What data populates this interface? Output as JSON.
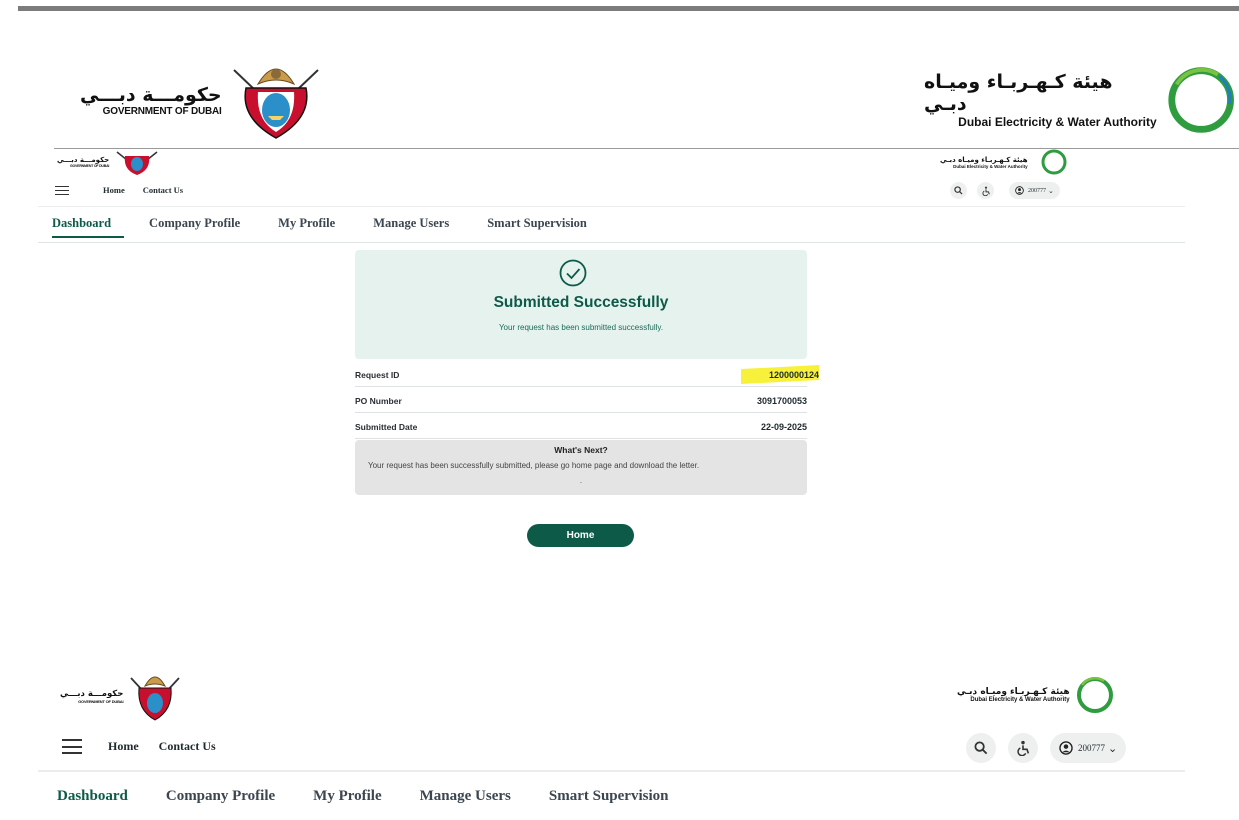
{
  "brand": {
    "gov_arabic": "حكومـــة دبـــي",
    "gov_english": "GOVERNMENT OF DUBAI",
    "dewa_arabic": "هيئة كـهـربـاء وميـاه دبـي",
    "dewa_english": "Dubai Electricity & Water Authority"
  },
  "nav": {
    "home": "Home",
    "contact": "Contact Us",
    "user_id": "200777"
  },
  "tabs": [
    "Dashboard",
    "Company Profile",
    "My Profile",
    "Manage Users",
    "Smart Supervision"
  ],
  "success": {
    "title": "Submitted Successfully",
    "message": "Your request has been submitted successfully."
  },
  "details": [
    {
      "label": "Request ID",
      "value": "1200000124"
    },
    {
      "label": "PO Number",
      "value": "3091700053"
    },
    {
      "label": "Submitted Date",
      "value": "22-09-2025"
    }
  ],
  "whats_next": {
    "title": "What's Next?",
    "text": "Your request has been successfully submitted, please go home page and download the letter.",
    "dot": "."
  },
  "home_button": "Home",
  "colors": {
    "brand_green": "#0d5a49",
    "success_bg": "#e6f2ee",
    "highlight": "#f7f13b"
  }
}
